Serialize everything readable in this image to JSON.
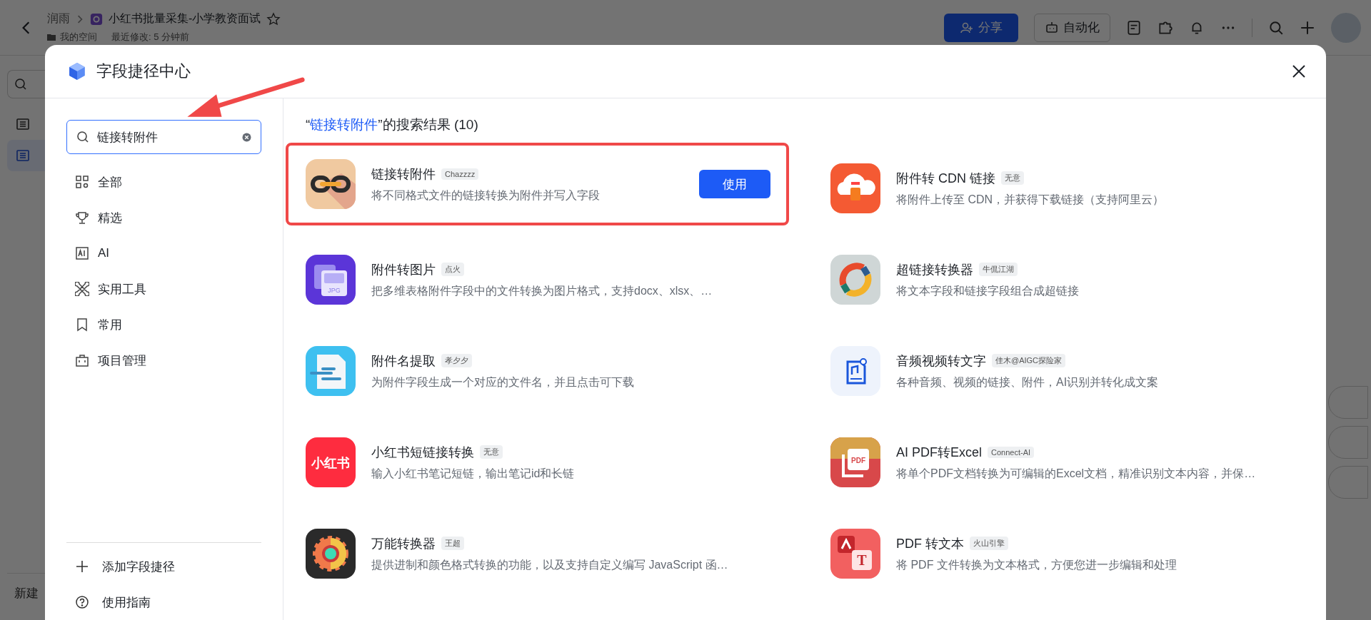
{
  "background": {
    "breadcrumb": "润雨",
    "doc_title": "小红书批量采集-小学教资面试",
    "space": "我的空间",
    "modified": "最近修改: 5 分钟前",
    "share_button": "分享",
    "automation_button": "自动化",
    "sidebar_items": [
      {
        "selected": false
      },
      {
        "selected": true
      }
    ],
    "new_button": "新建"
  },
  "dialog": {
    "title": "字段捷径中心",
    "search": {
      "value": "链接转附件"
    },
    "categories": [
      {
        "label": "全部"
      },
      {
        "label": "精选"
      },
      {
        "label": "AI"
      },
      {
        "label": "实用工具"
      },
      {
        "label": "常用"
      },
      {
        "label": "项目管理"
      }
    ],
    "footer_links": [
      {
        "label": "添加字段捷径"
      },
      {
        "label": "使用指南"
      }
    ],
    "results_heading": {
      "open_quote": "“",
      "query": "链接转附件",
      "rest": "”的搜索结果 (10)"
    },
    "items": [
      {
        "name": "链接转附件",
        "author": "Chazzzz",
        "description": "将不同格式文件的链接转换为附件并写入字段",
        "highlighted": true,
        "action": "使用"
      },
      {
        "name": "附件转 CDN 链接",
        "author": "无意",
        "description": "将附件上传至 CDN，并获得下载链接（支持阿里云）",
        "highlighted": false
      },
      {
        "name": "附件转图片",
        "author": "点火",
        "description": "把多维表格附件字段中的文件转换为图片格式，支持docx、xlsx、…",
        "icon_text": "JPG",
        "highlighted": false
      },
      {
        "name": "超链接转换器",
        "author": "牛侃江湖",
        "description": "将文本字段和链接字段组合成超链接",
        "highlighted": false
      },
      {
        "name": "附件名提取",
        "author": "孝夕夕",
        "description": "为附件字段生成一个对应的文件名，并且点击可下载",
        "highlighted": false
      },
      {
        "name": "音频视频转文字",
        "author": "佳木@AIGC探险家",
        "description": "各种音频、视频的链接、附件，AI识别并转化成文案",
        "highlighted": false
      },
      {
        "name": "小红书短链接转换",
        "author": "无意",
        "description": "输入小红书笔记短链，输出笔记id和长链",
        "icon_text": "小红书",
        "highlighted": false
      },
      {
        "name": "AI PDF转Excel",
        "author": "Connect-AI",
        "description": "将单个PDF文档转换为可编辑的Excel文档，精准识别文本内容，并保…",
        "icon_text": "PDF",
        "highlighted": false
      },
      {
        "name": "万能转换器",
        "author": "王超",
        "description": "提供进制和颜色格式转换的功能，以及支持自定义编写 JavaScript 函…",
        "highlighted": false
      },
      {
        "name": "PDF 转文本",
        "author": "火山引擎",
        "description": "将 PDF 文件转换为文本格式，方便您进一步编辑和处理",
        "icon_text": "T",
        "highlighted": false
      }
    ]
  }
}
